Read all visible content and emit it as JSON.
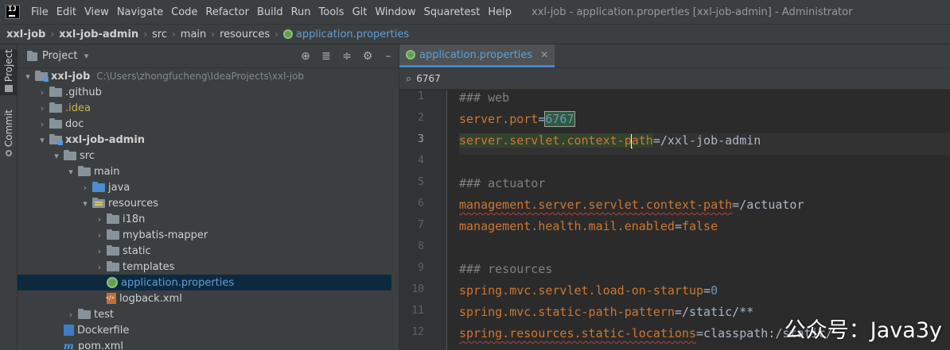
{
  "menu": {
    "items": [
      "File",
      "Edit",
      "View",
      "Navigate",
      "Code",
      "Refactor",
      "Build",
      "Run",
      "Tools",
      "Git",
      "Window",
      "Squaretest",
      "Help"
    ],
    "window_title": "xxl-job - application.properties [xxl-job-admin] - Administrator"
  },
  "breadcrumb": [
    "xxl-job",
    "xxl-job-admin",
    "src",
    "main",
    "resources",
    "application.properties"
  ],
  "toolstrip": {
    "project_label": "Project",
    "commit_label": "Commit"
  },
  "project": {
    "title": "Project",
    "root_name": "xxl-job",
    "root_path": "C:\\Users\\zhongfucheng\\IdeaProjects\\xxl-job",
    "items": [
      "xxl-job",
      ".github",
      ".idea",
      "doc",
      "xxl-job-admin",
      "src",
      "main",
      "java",
      "resources",
      "i18n",
      "mybatis-mapper",
      "static",
      "templates",
      "application.properties",
      "logback.xml",
      "test",
      "Dockerfile",
      "pom.xml"
    ]
  },
  "editor": {
    "tab_label": "application.properties",
    "search_value": "6767",
    "line_numbers": [
      "1",
      "2",
      "3",
      "4",
      "5",
      "6",
      "7",
      "8",
      "9",
      "10",
      "11",
      "12"
    ],
    "lines": [
      {
        "key": "### web"
      },
      {
        "key": "server.port",
        "eq": "=",
        "val": "6767"
      },
      {
        "key_a": "server.servlet.context-p",
        "key_b": "ath",
        "eq": "=",
        "val": "/xxl-job-admin"
      },
      {
        "key": ""
      },
      {
        "key": "### actuator"
      },
      {
        "key": "management.server.servlet.context-path",
        "eq": "=",
        "val": "/actuator"
      },
      {
        "key": "management.health.mail.enabled",
        "eq": "=",
        "val": "false"
      },
      {
        "key": ""
      },
      {
        "key": "### resources"
      },
      {
        "key": "spring.mvc.servlet.load-on-startup",
        "eq": "=",
        "val": "0"
      },
      {
        "key": "spring.mvc.static-path-pattern",
        "eq": "=",
        "val": "/static/**"
      },
      {
        "key": "spring.resources.static-locations",
        "eq": "=",
        "val": "classpath:/static/"
      }
    ]
  },
  "watermark": "公众号：Java3y",
  "colors": {
    "accent": "#5f9fd6",
    "keyword": "#cc7832",
    "value": "#6a8759",
    "comment": "#808080",
    "number": "#6897bb"
  }
}
